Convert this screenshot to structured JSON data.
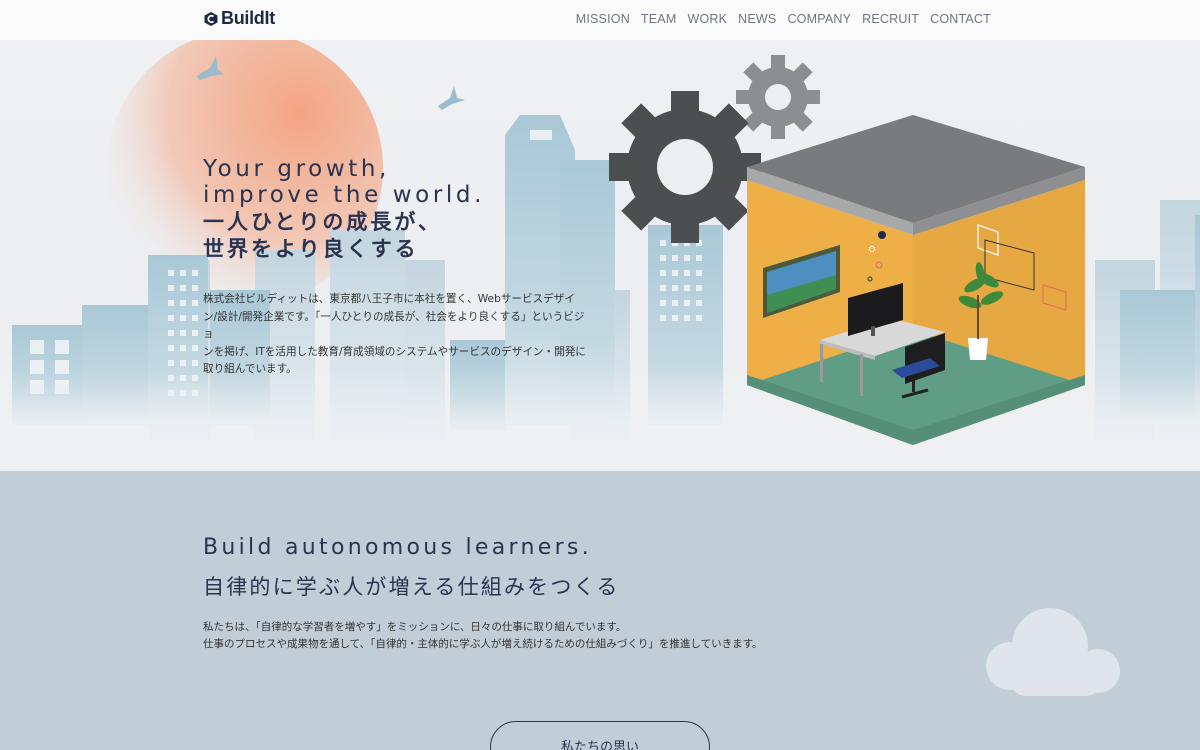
{
  "header": {
    "logo_text": "BuildIt",
    "nav": [
      "MISSION",
      "TEAM",
      "WORK",
      "NEWS",
      "COMPANY",
      "RECRUIT",
      "CONTACT"
    ]
  },
  "hero": {
    "en_line1": "Your growth,",
    "en_line2": "improve the world.",
    "ja_line1": "一人ひとりの成長が、",
    "ja_line2": "世界をより良くする",
    "description": [
      "株式会社ビルディットは、東京都八王子市に本社を置く、Webサービスデザイ",
      "ン/設計/開発企業です。「一人ひとりの成長が、社会をより良くする」というビジョ",
      "ンを掲げ、ITを活用した教育/育成領域のシステムやサービスのデザイン・開発に",
      "取り組んでいます。"
    ]
  },
  "mission": {
    "title_en": "Build autonomous learners.",
    "title_ja": "自律的に学ぶ人が増える仕組みをつくる",
    "description": [
      "私たちは、「自律的な学習者を増やす」をミッションに、日々の仕事に取り組んでいます。",
      "仕事のプロセスや成果物を通して、「自律的・主体的に学ぶ人が増え続けるための仕組みづくり」を推進していきます。"
    ],
    "button_label": "私たちの思い"
  },
  "colors": {
    "navy": "#2a3350",
    "room_wall": "#eeaf47",
    "room_floor": "#5f9e84",
    "gear": "#4d4e50",
    "mission_bg": "#c1ced8"
  },
  "icons": [
    "logo-mark-icon",
    "bird-icon",
    "gear-icon",
    "cloud-icon"
  ]
}
